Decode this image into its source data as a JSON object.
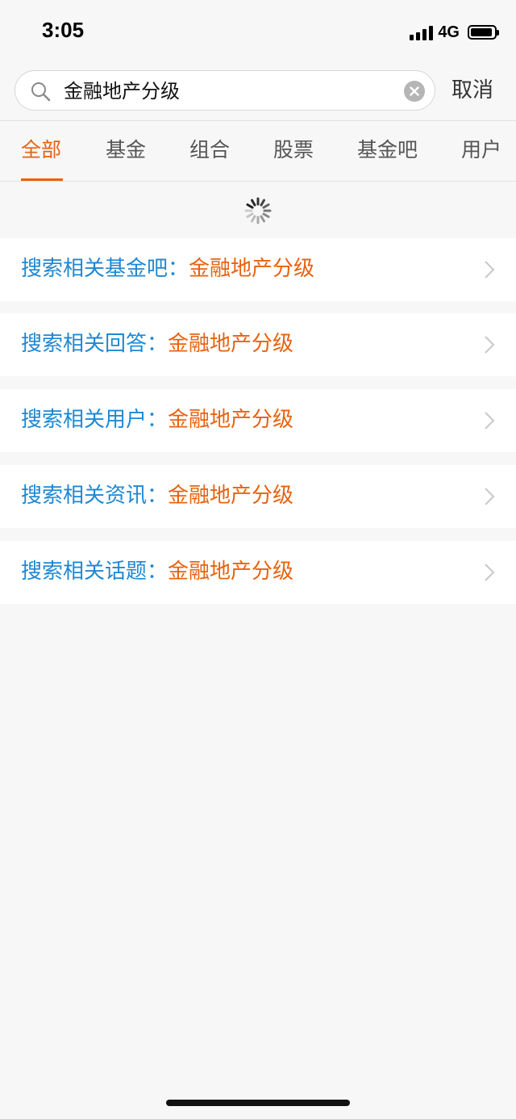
{
  "status": {
    "time": "3:05",
    "network": "4G"
  },
  "search": {
    "query": "金融地产分级",
    "cancel_label": "取消"
  },
  "tabs": [
    {
      "label": "全部",
      "active": true
    },
    {
      "label": "基金"
    },
    {
      "label": "组合"
    },
    {
      "label": "股票"
    },
    {
      "label": "基金吧"
    },
    {
      "label": "用户"
    }
  ],
  "results": [
    {
      "prefix": "搜索相关基金吧：",
      "query": "金融地产分级"
    },
    {
      "prefix": "搜索相关回答：",
      "query": "金融地产分级"
    },
    {
      "prefix": "搜索相关用户：",
      "query": "金融地产分级"
    },
    {
      "prefix": "搜索相关资讯：",
      "query": "金融地产分级"
    },
    {
      "prefix": "搜索相关话题：",
      "query": "金融地产分级"
    }
  ],
  "colors": {
    "accent": "#e8620f",
    "link": "#1e88d3",
    "background": "#f7f7f7"
  },
  "icons": [
    "search-icon",
    "clear-icon",
    "loading-spinner-icon",
    "chevron-right-icon",
    "signal-icon",
    "battery-icon"
  ]
}
